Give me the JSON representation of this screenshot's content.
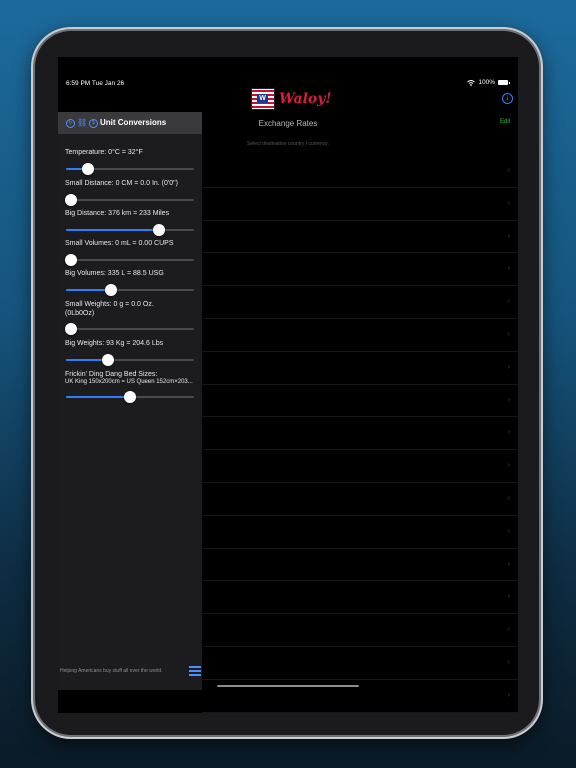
{
  "status_bar": {
    "time": "6:59 PM   Tue Jan 26",
    "battery": "100%"
  },
  "app": {
    "name": "Waloy!",
    "flag_letter": "W"
  },
  "sidebar": {
    "title": "Unit Conversions",
    "header_icons": [
      "refresh-icon",
      "link-icon",
      "dollar-icon"
    ],
    "conversions": [
      {
        "label": "Temperature:   0°C   =   32°F",
        "value": 0.17
      },
      {
        "label": "Small Distance:   0 CM   =   0.0 In. (0'0\")",
        "value": 0.04
      },
      {
        "label": "Big Distance:   376 km   =   233 Miles",
        "value": 0.73
      },
      {
        "label": "Small Volumes:   0 mL   =   0.00 CUPS",
        "value": 0.04
      },
      {
        "label": "Big Volumes:   335 L   =   88.5 USG",
        "value": 0.35
      },
      {
        "label": "Small Weights:   0 g   =   0.0 Oz.",
        "label2": "(0Lb0Oz)",
        "value": 0.04
      },
      {
        "label": "Big Weights:   93 Kg   =   204.6 Lbs",
        "value": 0.33
      },
      {
        "label": "Frickin' Ding Dang Bed Sizes:",
        "label2": "UK King 150x200cm = US Queen 152cm×203...",
        "value": 0.5
      }
    ],
    "footer": "Helping Americans buy stuff all over the world."
  },
  "main": {
    "title": "Exchange Rates",
    "edit_label": "Edit",
    "hint": "Select destination country / currency:",
    "row_count": 17
  },
  "colors": {
    "accent": "#2f7cf6",
    "brand_red": "#d91c3c",
    "edit_green": "#2bbf3f"
  }
}
